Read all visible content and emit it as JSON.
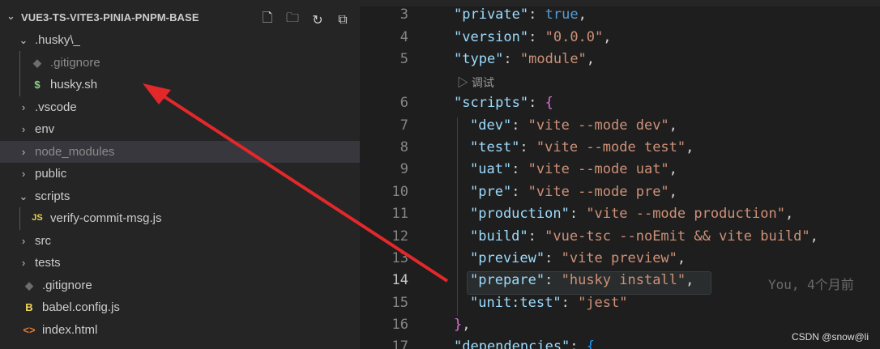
{
  "explorer": {
    "title": "VUE3-TS-VITE3-PINIA-PNPM-BASE",
    "actions": [
      {
        "name": "new-file-icon",
        "glyph": "🗋"
      },
      {
        "name": "new-folder-icon",
        "glyph": "🗀"
      },
      {
        "name": "refresh-icon",
        "glyph": "↻"
      },
      {
        "name": "collapse-all-icon",
        "glyph": "⧉"
      }
    ],
    "items": [
      {
        "label": ".husky\\_",
        "type": "folder",
        "open": true,
        "depth": 0
      },
      {
        "label": ".gitignore",
        "type": "gitignore",
        "depth": 1,
        "dim": true
      },
      {
        "label": "husky.sh",
        "type": "shell",
        "depth": 1
      },
      {
        "label": ".vscode",
        "type": "folder",
        "open": false,
        "depth": 0
      },
      {
        "label": "env",
        "type": "folder",
        "open": false,
        "depth": 0
      },
      {
        "label": "node_modules",
        "type": "folder",
        "open": false,
        "depth": 0,
        "dim": true,
        "selected": true
      },
      {
        "label": "public",
        "type": "folder",
        "open": false,
        "depth": 0
      },
      {
        "label": "scripts",
        "type": "folder",
        "open": true,
        "depth": 0
      },
      {
        "label": "verify-commit-msg.js",
        "type": "js",
        "depth": 1
      },
      {
        "label": "src",
        "type": "folder",
        "open": false,
        "depth": 0
      },
      {
        "label": "tests",
        "type": "folder",
        "open": false,
        "depth": 0
      },
      {
        "label": ".gitignore",
        "type": "gitignore",
        "depth": 0
      },
      {
        "label": "babel.config.js",
        "type": "babel",
        "depth": 0
      },
      {
        "label": "index.html",
        "type": "html",
        "depth": 0
      }
    ]
  },
  "editor": {
    "codelens": "调试",
    "current_line": "14",
    "blame": "You, 4个月前",
    "lines": [
      {
        "n": "3",
        "indent": 1,
        "tokens": [
          [
            "k",
            "\"private\""
          ],
          [
            "p",
            ": "
          ],
          [
            "b",
            "true"
          ],
          [
            "p",
            ","
          ]
        ]
      },
      {
        "n": "4",
        "indent": 1,
        "tokens": [
          [
            "k",
            "\"version\""
          ],
          [
            "p",
            ": "
          ],
          [
            "s",
            "\"0.0.0\""
          ],
          [
            "p",
            ","
          ]
        ]
      },
      {
        "n": "5",
        "indent": 1,
        "tokens": [
          [
            "k",
            "\"type\""
          ],
          [
            "p",
            ": "
          ],
          [
            "s",
            "\"module\""
          ],
          [
            "p",
            ","
          ]
        ]
      },
      {
        "n": "6",
        "indent": 1,
        "tokens": [
          [
            "k",
            "\"scripts\""
          ],
          [
            "p",
            ": "
          ],
          [
            "br1",
            "{"
          ]
        ]
      },
      {
        "n": "7",
        "indent": 2,
        "tokens": [
          [
            "k",
            "\"dev\""
          ],
          [
            "p",
            ": "
          ],
          [
            "s",
            "\"vite --mode dev\""
          ],
          [
            "p",
            ","
          ]
        ]
      },
      {
        "n": "8",
        "indent": 2,
        "tokens": [
          [
            "k",
            "\"test\""
          ],
          [
            "p",
            ": "
          ],
          [
            "s",
            "\"vite --mode test\""
          ],
          [
            "p",
            ","
          ]
        ]
      },
      {
        "n": "9",
        "indent": 2,
        "tokens": [
          [
            "k",
            "\"uat\""
          ],
          [
            "p",
            ": "
          ],
          [
            "s",
            "\"vite --mode uat\""
          ],
          [
            "p",
            ","
          ]
        ]
      },
      {
        "n": "10",
        "indent": 2,
        "tokens": [
          [
            "k",
            "\"pre\""
          ],
          [
            "p",
            ": "
          ],
          [
            "s",
            "\"vite --mode pre\""
          ],
          [
            "p",
            ","
          ]
        ]
      },
      {
        "n": "11",
        "indent": 2,
        "tokens": [
          [
            "k",
            "\"production\""
          ],
          [
            "p",
            ": "
          ],
          [
            "s",
            "\"vite --mode production\""
          ],
          [
            "p",
            ","
          ]
        ]
      },
      {
        "n": "12",
        "indent": 2,
        "tokens": [
          [
            "k",
            "\"build\""
          ],
          [
            "p",
            ": "
          ],
          [
            "s",
            "\"vue-tsc --noEmit && vite build\""
          ],
          [
            "p",
            ","
          ]
        ]
      },
      {
        "n": "13",
        "indent": 2,
        "tokens": [
          [
            "k",
            "\"preview\""
          ],
          [
            "p",
            ": "
          ],
          [
            "s",
            "\"vite preview\""
          ],
          [
            "p",
            ","
          ]
        ]
      },
      {
        "n": "14",
        "indent": 2,
        "tokens": [
          [
            "k",
            "\"prepare\""
          ],
          [
            "p",
            ": "
          ],
          [
            "s",
            "\"husky install\""
          ],
          [
            "p",
            ","
          ]
        ]
      },
      {
        "n": "15",
        "indent": 2,
        "tokens": [
          [
            "k",
            "\"unit:test\""
          ],
          [
            "p",
            ": "
          ],
          [
            "s",
            "\"jest\""
          ]
        ]
      },
      {
        "n": "16",
        "indent": 1,
        "tokens": [
          [
            "br1",
            "}"
          ],
          [
            "p",
            ","
          ]
        ]
      },
      {
        "n": "17",
        "indent": 1,
        "tokens": [
          [
            "k",
            "\"dependencies\""
          ],
          [
            "p",
            ": "
          ],
          [
            "br2",
            "{"
          ]
        ]
      }
    ]
  },
  "watermark": "CSDN @snow@li",
  "colors": {
    "annotation_arrow": "#e3282a"
  }
}
